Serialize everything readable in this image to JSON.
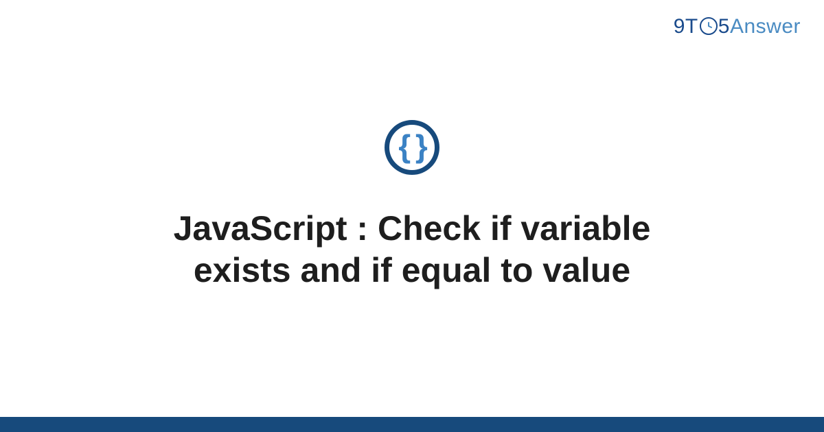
{
  "brand": {
    "part_9t": "9T",
    "part_5": "5",
    "part_answer": "Answer"
  },
  "icon": {
    "braces": "{ }"
  },
  "heading": {
    "line1": "JavaScript : Check if variable",
    "line2": "exists and if equal to value"
  }
}
